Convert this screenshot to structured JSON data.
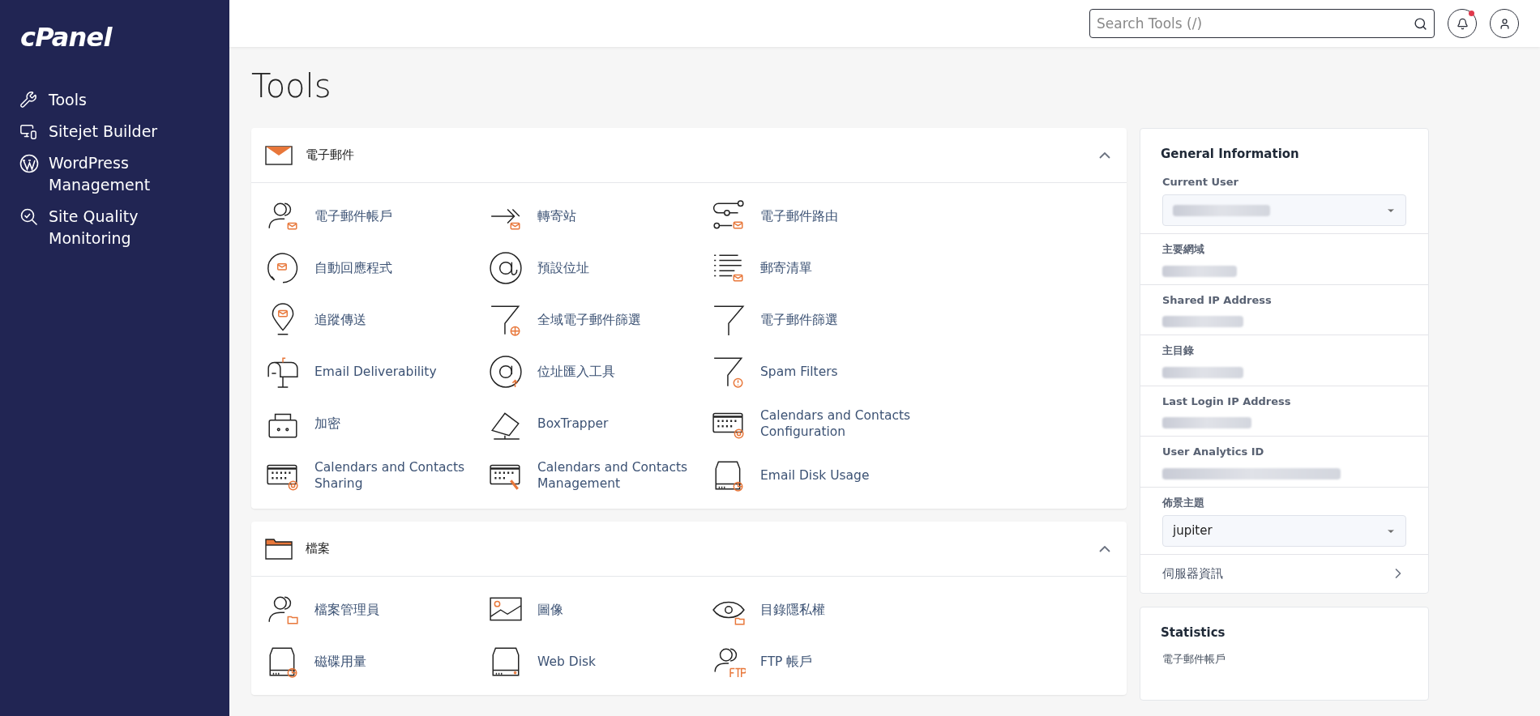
{
  "sidebar": {
    "logo": "cPanel",
    "items": [
      {
        "label": "Tools"
      },
      {
        "label": "Sitejet Builder"
      },
      {
        "label": "WordPress Management"
      },
      {
        "label": "Site Quality Monitoring"
      }
    ]
  },
  "topbar": {
    "search": {
      "placeholder": "Search Tools (/)"
    },
    "has_notification": true
  },
  "page_title": "Tools",
  "sections": [
    {
      "title": "電子郵件",
      "expanded": true,
      "items": [
        {
          "label": "電子郵件帳戶"
        },
        {
          "label": "轉寄站"
        },
        {
          "label": "電子郵件路由"
        },
        {
          "label": "自動回應程式"
        },
        {
          "label": "預設位址"
        },
        {
          "label": "郵寄清單"
        },
        {
          "label": "追蹤傳送"
        },
        {
          "label": "全域電子郵件篩選"
        },
        {
          "label": "電子郵件篩選"
        },
        {
          "label": "Email Deliverability"
        },
        {
          "label": "位址匯入工具"
        },
        {
          "label": "Spam Filters"
        },
        {
          "label": "加密"
        },
        {
          "label": "BoxTrapper"
        },
        {
          "label": "Calendars and Contacts Configuration"
        },
        {
          "label": "Calendars and Contacts Sharing"
        },
        {
          "label": "Calendars and Contacts Management"
        },
        {
          "label": "Email Disk Usage"
        }
      ]
    },
    {
      "title": "檔案",
      "expanded": true,
      "items": [
        {
          "label": "檔案管理員"
        },
        {
          "label": "圖像"
        },
        {
          "label": "目錄隱私權"
        },
        {
          "label": "磁碟用量"
        },
        {
          "label": "Web Disk"
        },
        {
          "label": "FTP 帳戶"
        }
      ]
    }
  ],
  "general_information": {
    "title": "General Information",
    "fields": [
      {
        "kind": "select",
        "label": "Current User"
      },
      {
        "kind": "text",
        "label": "主要網域"
      },
      {
        "kind": "text",
        "label": "Shared IP Address"
      },
      {
        "kind": "text",
        "label": "主目錄"
      },
      {
        "kind": "text",
        "label": "Last Login IP Address"
      },
      {
        "kind": "text",
        "label": "User Analytics ID"
      },
      {
        "kind": "select",
        "label": "佈景主題",
        "value": "jupiter"
      },
      {
        "kind": "link",
        "label": "伺服器資訊"
      }
    ]
  },
  "statistics": {
    "title": "Statistics",
    "items": [
      {
        "label": "電子郵件帳戶"
      }
    ]
  }
}
